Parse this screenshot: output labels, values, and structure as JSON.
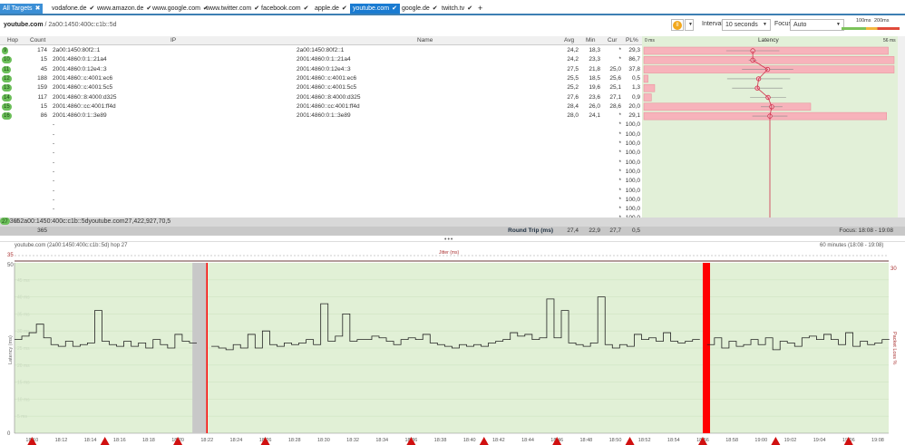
{
  "tabs": [
    {
      "label": "All Targets",
      "icon": "close-icon",
      "selected": false,
      "all": true
    },
    {
      "label": "vodafone.de"
    },
    {
      "label": "www.amazon.de"
    },
    {
      "label": "www.google.com"
    },
    {
      "label": "www.twitter.com"
    },
    {
      "label": "facebook.com"
    },
    {
      "label": "apple.de"
    },
    {
      "label": "youtube.com",
      "selected": true
    },
    {
      "label": "google.de"
    },
    {
      "label": "twitch.tv"
    }
  ],
  "add_tab": "+",
  "breadcrumb": {
    "target": "youtube.com",
    "sep": " / ",
    "ip": "2a00:1450:400c:c1b::5d"
  },
  "controls": {
    "pause_icon": "pause-icon",
    "interval_label": "Interval",
    "interval_value": "10 seconds",
    "focus_label": "Focus",
    "focus_value": "Auto",
    "scale_100": "100ms",
    "scale_200": "200ms",
    "colors": {
      "good": "#7cc35a",
      "warn": "#f3b63d",
      "bad": "#e04a3a"
    }
  },
  "table": {
    "headers": {
      "hop": "Hop",
      "count": "Count",
      "ip": "IP",
      "name": "Name",
      "avg": "Avg",
      "min": "Min",
      "cur": "Cur",
      "pl": "PL%",
      "latency": "Latency",
      "lat_min": "0 ms",
      "lat_max": "56 ms"
    },
    "rows": [
      {
        "hop": "9",
        "count": "174",
        "ip": "2a00:1450:80f2::1",
        "name": "2a00:1450:80f2::1",
        "avg": "24,2",
        "min": "18,3",
        "cur": "*",
        "pl": "29,3"
      },
      {
        "hop": "10",
        "count": "15",
        "ip": "2001:4860:0:1::21a4",
        "name": "2001:4860:0:1::21a4",
        "avg": "24,2",
        "min": "23,3",
        "cur": "*",
        "pl": "86,7"
      },
      {
        "hop": "11",
        "count": "45",
        "ip": "2001:4860:0:12e4::3",
        "name": "2001:4860:0:12e4::3",
        "avg": "27,5",
        "min": "21,8",
        "cur": "25,0",
        "pl": "37,8"
      },
      {
        "hop": "12",
        "count": "188",
        "ip": "2001:4860::c:4001:ec6",
        "name": "2001:4860::c:4001:ec6",
        "avg": "25,5",
        "min": "18,5",
        "cur": "25,6",
        "pl": "0,5"
      },
      {
        "hop": "13",
        "count": "159",
        "ip": "2001:4860::c:4001:5c5",
        "name": "2001:4860::c:4001:5c5",
        "avg": "25,2",
        "min": "19,6",
        "cur": "25,1",
        "pl": "1,3"
      },
      {
        "hop": "14",
        "count": "117",
        "ip": "2001:4860::8:4000:d325",
        "name": "2001:4860::8:4000:d325",
        "avg": "27,6",
        "min": "23,6",
        "cur": "27,1",
        "pl": "0,9"
      },
      {
        "hop": "15",
        "count": "15",
        "ip": "2001:4860::cc:4001:ff4d",
        "name": "2001:4860::cc:4001:ff4d",
        "avg": "28,4",
        "min": "26,0",
        "cur": "28,6",
        "pl": "20,0"
      },
      {
        "hop": "16",
        "count": "86",
        "ip": "2001:4860:0:1::3e89",
        "name": "2001:4860:0:1::3e89",
        "avg": "28,0",
        "min": "24,1",
        "cur": "*",
        "pl": "29,1"
      },
      {
        "ip": "-",
        "cur": "*",
        "pl": "100,0"
      },
      {
        "ip": "-",
        "cur": "*",
        "pl": "100,0"
      },
      {
        "ip": "-",
        "cur": "*",
        "pl": "100,0"
      },
      {
        "ip": "-",
        "cur": "*",
        "pl": "100,0"
      },
      {
        "ip": "-",
        "cur": "*",
        "pl": "100,0"
      },
      {
        "ip": "-",
        "cur": "*",
        "pl": "100,0"
      },
      {
        "ip": "-",
        "cur": "*",
        "pl": "100,0"
      },
      {
        "ip": "-",
        "cur": "*",
        "pl": "100,0"
      },
      {
        "ip": "-",
        "cur": "*",
        "pl": "100,0"
      },
      {
        "ip": "-",
        "cur": "*",
        "pl": "100,0"
      },
      {
        "ip": "-",
        "cur": "*",
        "pl": "100,0"
      }
    ],
    "final": {
      "hop": "27",
      "count": "365",
      "ip": "2a00:1450:400c:c1b::5d",
      "name": "youtube.com",
      "avg": "27,4",
      "min": "22,9",
      "cur": "27,7",
      "pl": "0,5"
    },
    "summary": {
      "count": "365",
      "label": "Round Trip (ms)",
      "avg": "27,4",
      "min": "22,9",
      "cur": "27,7",
      "pl": "0,5",
      "focus": "Focus: 18:08 - 19:08"
    }
  },
  "graph": {
    "title": "youtube.com (2a00:1450:400c:c1b::5d) hop 27",
    "range": "60 minutes (18:08 - 19:08)",
    "jitter_label": "Jitter (ms)",
    "jitter_max": "35"
  },
  "chart_data": {
    "type": "line",
    "ylabel": "Latency (ms)",
    "y2label": "Packet Loss %",
    "ylim": [
      0,
      50
    ],
    "y_ticks": [
      "50",
      "0"
    ],
    "y_grid_labels": [
      "45 ms",
      "40 ms",
      "35 ms",
      "30 ms",
      "25 ms",
      "20 ms",
      "15 ms",
      "10 ms",
      "5 ms"
    ],
    "y2_tick": "30",
    "x_ticks": [
      "18:10",
      "18:12",
      "18:14",
      "18:16",
      "18:18",
      "18:20",
      "18:22",
      "18:24",
      "18:26",
      "18:28",
      "18:30",
      "18:32",
      "18:34",
      "18:36",
      "18:38",
      "18:40",
      "18:42",
      "18:44",
      "18:46",
      "18:48",
      "18:50",
      "18:52",
      "18:54",
      "18:56",
      "18:58",
      "19:00",
      "19:02",
      "19:04",
      "19:06",
      "19:08"
    ],
    "sample_interval_s": 30,
    "start": "18:08:48",
    "latency_ms": [
      27.5,
      28.5,
      29.5,
      32,
      28,
      26,
      25.5,
      27,
      25.5,
      26,
      26.5,
      36,
      27,
      26,
      25.5,
      27,
      25.5,
      26.5,
      25,
      27.5,
      26,
      25,
      29,
      27,
      26.5,
      null,
      null,
      25.5,
      25,
      24.5,
      26,
      25,
      29,
      25,
      30,
      26,
      25.5,
      26.5,
      26,
      26.5,
      27.5,
      26,
      38,
      27,
      28.5,
      35,
      27,
      27.5,
      27.5,
      28.5,
      28,
      27,
      26,
      27.5,
      28,
      27.5,
      29,
      26.5,
      26,
      25.5,
      25,
      26,
      25.5,
      26,
      25.5,
      26.5,
      27,
      27.5,
      29.5,
      28.5,
      29,
      27.5,
      28,
      39.4,
      28,
      36,
      26.5,
      26,
      25.5,
      26.5,
      40,
      26,
      25,
      26,
      25.5,
      29,
      27.5,
      28,
      27,
      29.5,
      27,
      26.5,
      27,
      27.5,
      null,
      26,
      28,
      25,
      27,
      25.5,
      26,
      27.5,
      26,
      28,
      24.5,
      27,
      26.5,
      25.5,
      28,
      28.5,
      27.5,
      29,
      27.5,
      26,
      29.5,
      25.5,
      27,
      26,
      26.5,
      27.5
    ],
    "no_data_ranges": [
      [
        "18:21",
        "18:22"
      ]
    ],
    "packet_loss_100": [
      [
        "18:56",
        "18:56:30"
      ]
    ],
    "loss_marker_at": [
      "18:22"
    ],
    "loss_events": [
      "18:10",
      "18:15",
      "18:20",
      "18:26",
      "18:36",
      "18:41",
      "18:46",
      "18:51",
      "18:56",
      "19:01",
      "19:06"
    ],
    "colors": {
      "background": "#e1f0d6",
      "line": "#222222",
      "loss": "#ff0000",
      "gap": "#c8c8c8",
      "marker": "#d01010"
    }
  }
}
